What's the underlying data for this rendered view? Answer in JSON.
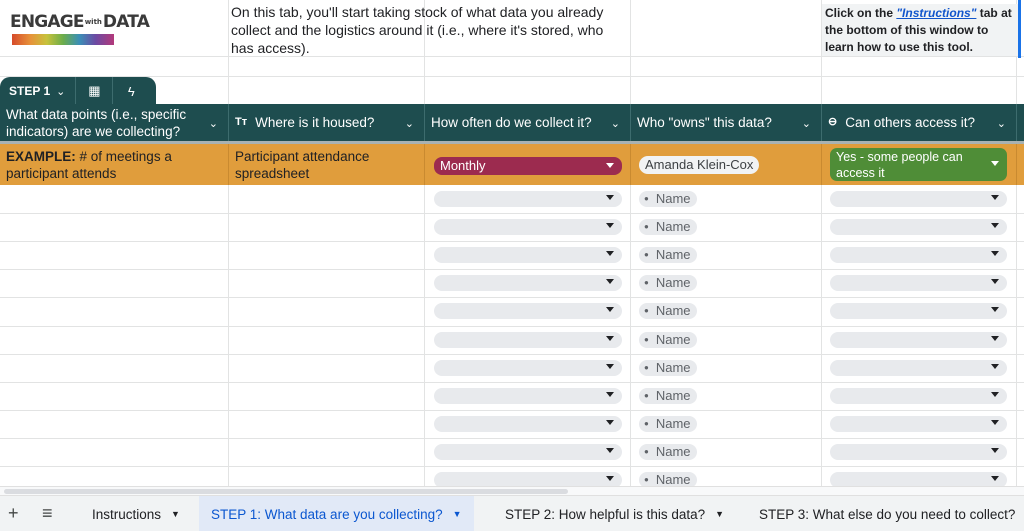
{
  "logo": {
    "word1": "ENGAGE",
    "word_small": "with",
    "word2": "DATA"
  },
  "intro_text": "On this tab, you'll start taking stock of what data you already collect and the logistics around it (i.e., where it's stored, who has access).",
  "note": {
    "prefix": "Click on the ",
    "link": "\"Instructions\"",
    "suffix": " tab at the bottom of this window to learn how to use this tool."
  },
  "table_tab": {
    "name": "STEP 1"
  },
  "columns": [
    {
      "label": "What data points (i.e., specific indicators) are we collecting?",
      "icon": ""
    },
    {
      "label": "Where is it housed?",
      "icon": "Tт"
    },
    {
      "label": "How often do we collect it?",
      "icon": ""
    },
    {
      "label": "Who \"owns\" this data?",
      "icon": ""
    },
    {
      "label": "Can others access it?",
      "icon": "⊖"
    }
  ],
  "example_row": {
    "lead": "EXAMPLE:",
    "data_point": " # of meetings a participant attends",
    "housed": "Participant attendance spreadsheet",
    "frequency": "Monthly",
    "owner": "Amanda Klein-Cox",
    "access": "Yes - some people can access it"
  },
  "name_placeholder": "Name",
  "sheet_tabs": [
    {
      "label": "Instructions",
      "active": false
    },
    {
      "label": "STEP 1: What data are you collecting?",
      "active": true
    },
    {
      "label": "STEP 2: How helpful is this data?",
      "active": false
    },
    {
      "label": "STEP 3: What else do you need to collect?",
      "active": false
    }
  ],
  "colors": {
    "header": "#1e4d4f",
    "example_row": "#e09d3c",
    "monthly_chip": "#9c2b4f",
    "yes_chip": "#4f8d37",
    "active_tab": "#0b57d0"
  }
}
